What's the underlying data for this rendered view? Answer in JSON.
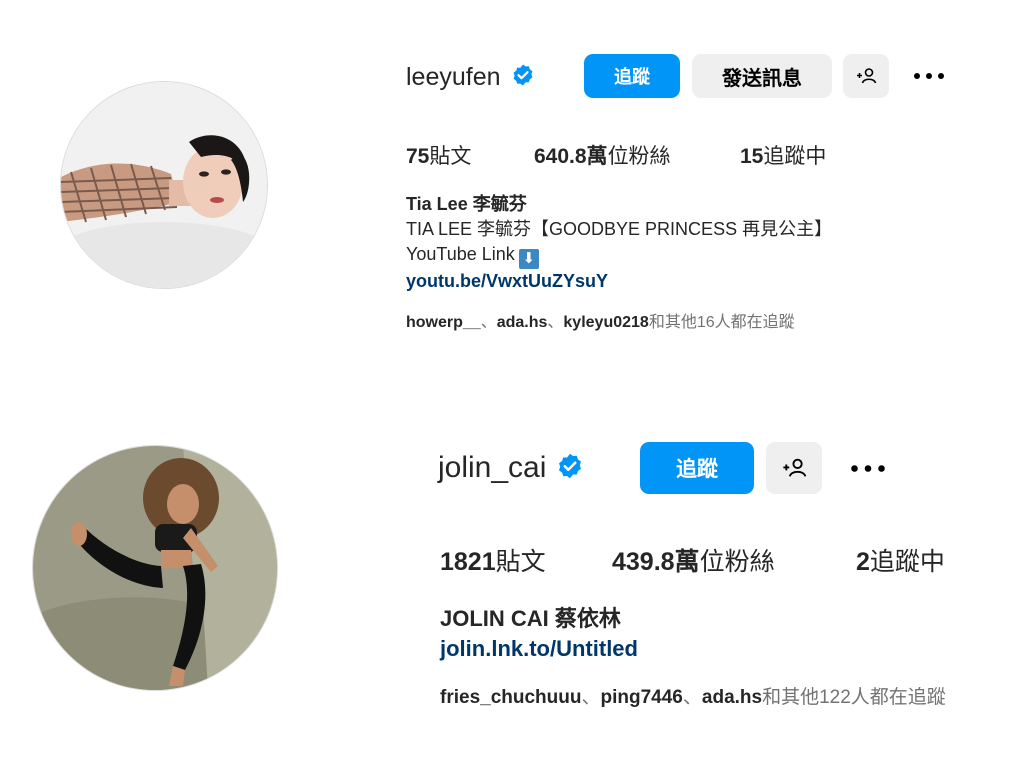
{
  "profiles": [
    {
      "username": "leeyufen",
      "verified": true,
      "buttons": {
        "follow": "追蹤",
        "message": "發送訊息"
      },
      "stats": {
        "posts_value": "75",
        "posts_label": "貼文",
        "followers_value": "640.8萬",
        "followers_label": "位粉絲",
        "following_value": "15",
        "following_label": "追蹤中"
      },
      "bio": {
        "name": "Tia Lee 李毓芬",
        "line1": "TIA LEE 李毓芬【GOODBYE PRINCESS 再見公主】",
        "line2": "YouTube Link",
        "line2_emoji": "⬇",
        "link": "youtu.be/VwxtUuZYsuY"
      },
      "followed_by": {
        "users": [
          "howerp__",
          "ada.hs",
          "kyleyu0218"
        ],
        "separator": "、",
        "suffix": "和其他16人都在追蹤"
      }
    },
    {
      "username": "jolin_cai",
      "verified": true,
      "buttons": {
        "follow": "追蹤"
      },
      "stats": {
        "posts_value": "1821",
        "posts_label": "貼文",
        "followers_value": "439.8萬",
        "followers_label": "位粉絲",
        "following_value": "2",
        "following_label": "追蹤中"
      },
      "bio": {
        "name": "JOLIN CAI 蔡依林",
        "link": "jolin.lnk.to/Untitled"
      },
      "followed_by": {
        "users": [
          "fries_chuchuuu",
          "ping7446",
          "ada.hs"
        ],
        "separator": "、",
        "suffix": "和其他122人都在追蹤"
      }
    }
  ],
  "icons": {
    "verified": "verified-badge-icon",
    "suggest": "add-person-icon",
    "more": "more-options-icon"
  },
  "colors": {
    "follow_button": "#0095f6",
    "secondary_button": "#efefef",
    "link": "#00376b",
    "verified": "#0095f6",
    "muted_text": "#737373"
  }
}
